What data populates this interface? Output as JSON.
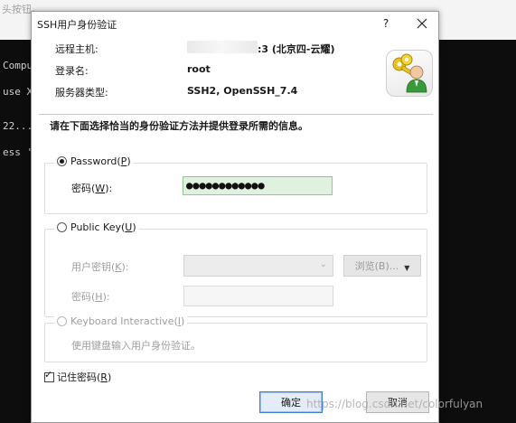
{
  "background": {
    "top_text": "头按钮。",
    "terminal_lines": [
      "Compu",
      "use Xs",
      "22...",
      "ess 'C"
    ]
  },
  "dialog": {
    "title": "SSH用户身份验证",
    "help_label": "?",
    "close_label": "✕",
    "info": {
      "remote_host_label": "远程主机:",
      "remote_host_value": ":3 (北京四-云耀)",
      "login_label": "登录名:",
      "login_value": "root",
      "server_type_label": "服务器类型:",
      "server_type_value": "SSH2, OpenSSH_7.4"
    },
    "instruction": "请在下面选择恰当的身份验证方法并提供登录所需的信息。",
    "password_group": {
      "label": "Password(",
      "label_key": "P",
      "label_end": ")",
      "field_label": "密码(",
      "field_key": "W",
      "field_end": "):",
      "value": "●●●●●●●●●●●●"
    },
    "publickey_group": {
      "label": "Public Key(",
      "label_key": "U",
      "label_end": ")",
      "user_key_label": "用户密钥(",
      "user_key_key": "K",
      "user_key_end": "):",
      "browse_label": "浏览(B)...",
      "passphrase_label": "密码(",
      "passphrase_key": "H",
      "passphrase_end": "):"
    },
    "keyboard_group": {
      "label": "Keyboard Interactive(",
      "label_key": "I",
      "label_end": ")",
      "description": "使用键盘输入用户身份验证。"
    },
    "remember_password": {
      "label": "记住密码(",
      "key": "R",
      "end": ")",
      "checked": true
    },
    "ok_label": "确定",
    "cancel_label": "取消"
  },
  "watermark": "https://blog.csdn.net/colorfulyan",
  "colors": {
    "accent": "#3d7fd3",
    "password_field_bg": "#dff1df",
    "terminal_bg": "#0d0d0d"
  },
  "icons": {
    "logo": "keys-user-icon",
    "dropdown": "chevron-down-icon",
    "check": "check-icon"
  }
}
